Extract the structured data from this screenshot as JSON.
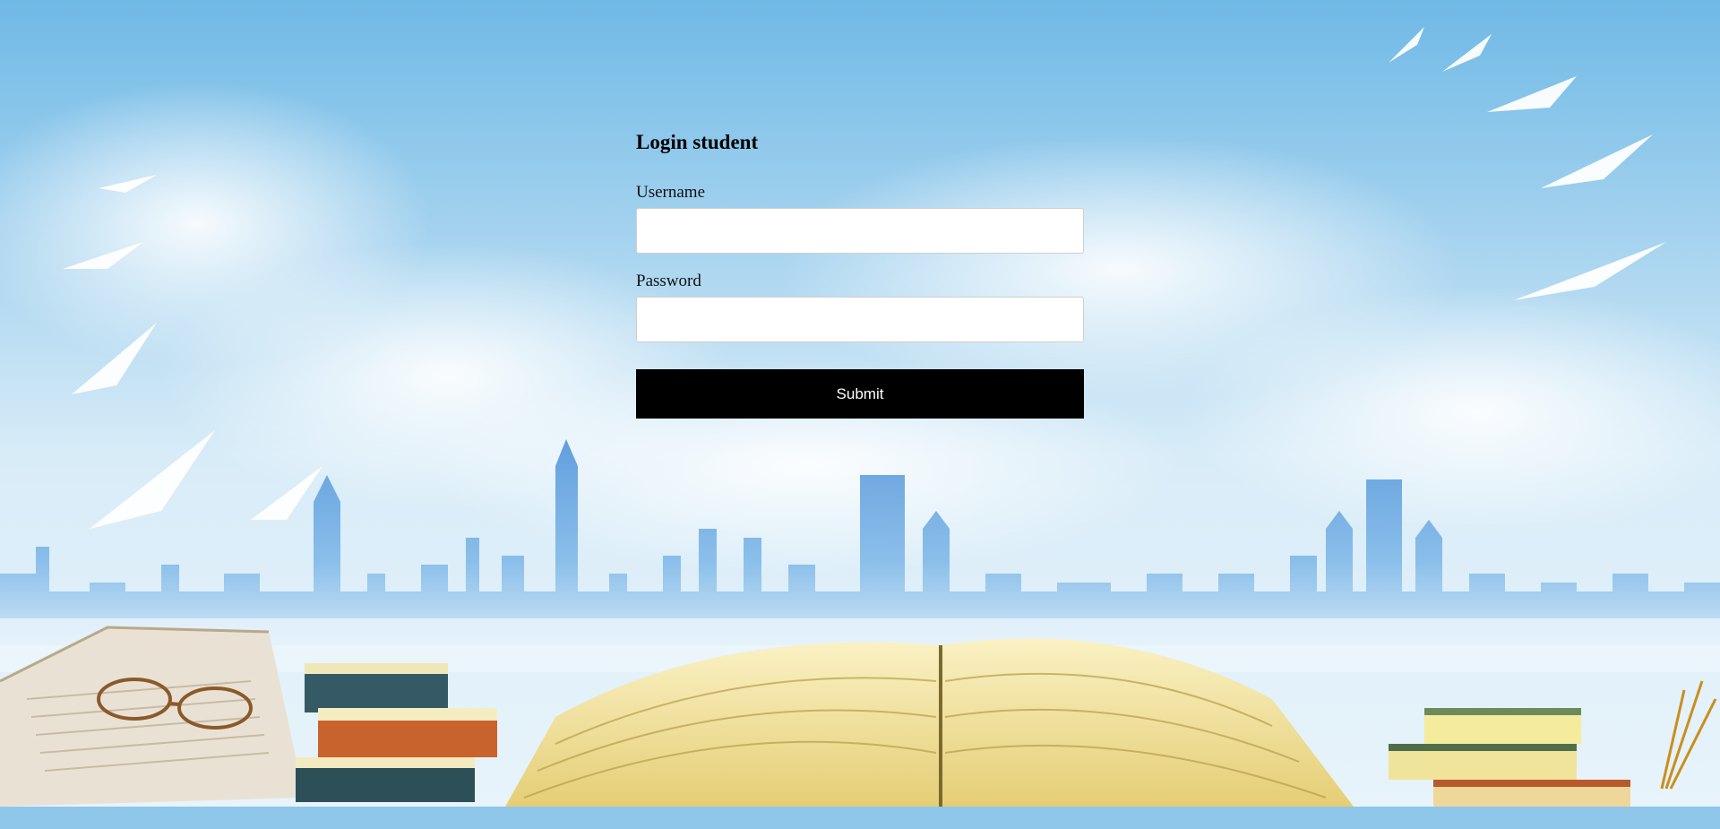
{
  "login": {
    "title": "Login student",
    "username_label": "Username",
    "username_value": "",
    "password_label": "Password",
    "password_value": "",
    "submit_label": "Submit"
  },
  "colors": {
    "sky_top": "#7fc2e8",
    "sky_bottom": "#e3f1fa",
    "skyline": "#5fa3de",
    "book_pages": "#f1e29a",
    "button": "#000000",
    "button_text": "#ffffff"
  }
}
